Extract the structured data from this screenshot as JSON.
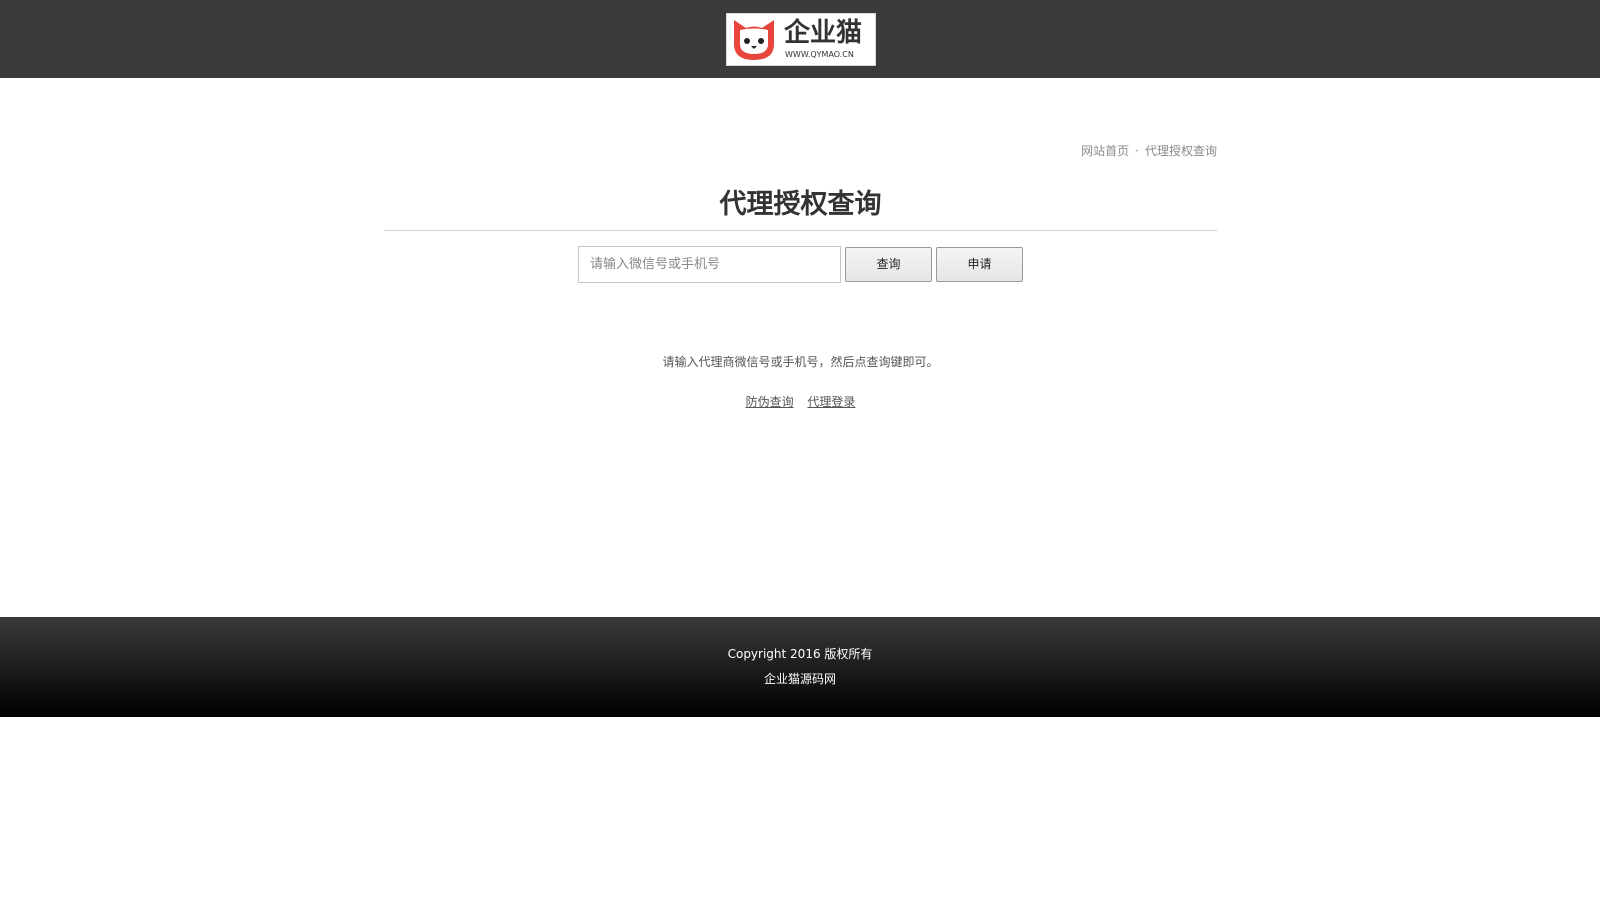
{
  "header": {
    "logo": {
      "name": "企业猫",
      "url": "WWW.QYMAO.CN",
      "brand_color": "#e8453c"
    },
    "background_color": "#3a3a3c"
  },
  "breadcrumb": {
    "home": "网站首页",
    "separator": "·",
    "current": "代理授权查询"
  },
  "main": {
    "title": "代理授权查询",
    "search": {
      "placeholder": "请输入微信号或手机号",
      "value": ""
    },
    "query_button": "查询",
    "apply_button": "申请",
    "hint": "请输入代理商微信号或手机号，然后点查询键即可。",
    "links": {
      "anti_fake": "防伪查询",
      "agent_login": "代理登录"
    }
  },
  "footer": {
    "copyright": "Copyright 2016 版权所有",
    "site_link": "企业猫源码网"
  }
}
